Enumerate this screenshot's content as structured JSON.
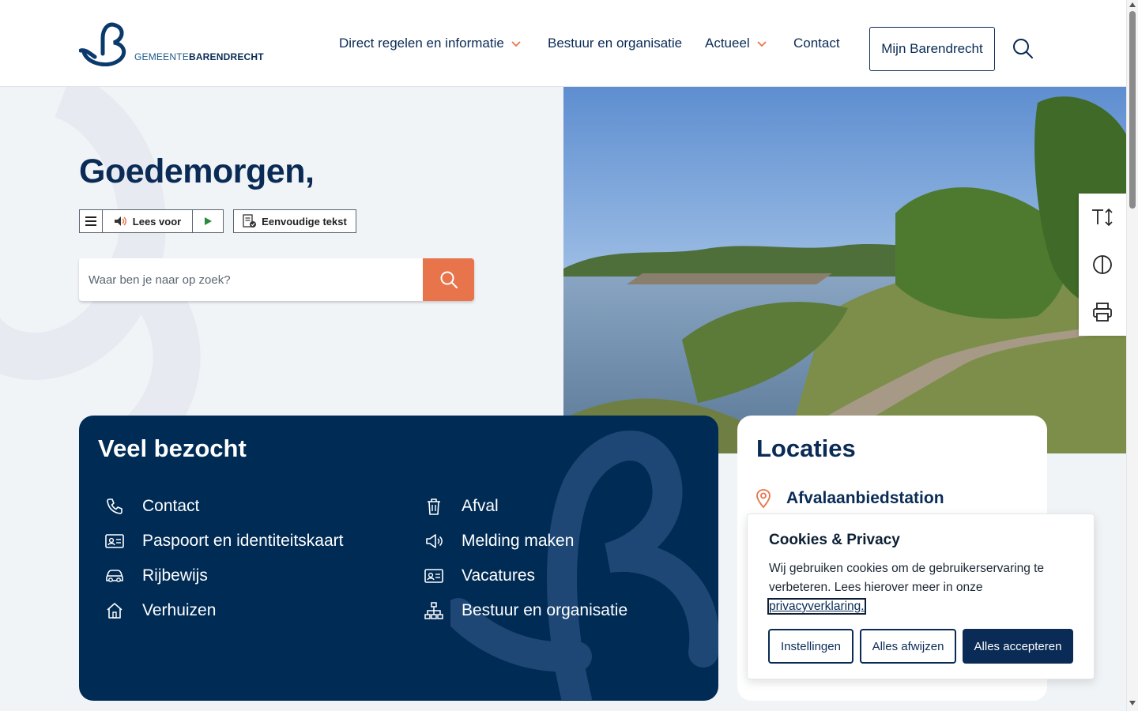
{
  "header": {
    "logo_prefix": "GEMEENTE",
    "logo_name": "BARENDRECHT",
    "nav": [
      {
        "label": "Direct regelen en informatie",
        "has_dropdown": true
      },
      {
        "label": "Bestuur en organisatie",
        "has_dropdown": false
      },
      {
        "label": "Actueel",
        "has_dropdown": true
      },
      {
        "label": "Contact",
        "has_dropdown": false
      }
    ],
    "mijn_label": "Mijn Barendrecht",
    "search_icon": "magnifier-icon"
  },
  "hero": {
    "greeting": "Goedemorgen,",
    "readspeaker": {
      "menu_icon": "menu-icon",
      "lees_voor": "Lees voor",
      "play_icon": "play-icon"
    },
    "simple_text": "Eenvoudige tekst",
    "search": {
      "placeholder": "Waar ben je naar op zoek?",
      "value": ""
    }
  },
  "tools": [
    {
      "name": "text-size-icon"
    },
    {
      "name": "contrast-icon"
    },
    {
      "name": "print-icon"
    }
  ],
  "veel_bezocht": {
    "title": "Veel bezocht",
    "links": [
      {
        "label": "Contact",
        "icon": "phone-icon"
      },
      {
        "label": "Paspoort en identiteitskaart",
        "icon": "id-card-icon"
      },
      {
        "label": "Rijbewijs",
        "icon": "car-icon"
      },
      {
        "label": "Verhuizen",
        "icon": "home-icon"
      },
      {
        "label": "Afval",
        "icon": "trash-icon"
      },
      {
        "label": "Melding maken",
        "icon": "megaphone-icon"
      },
      {
        "label": "Vacatures",
        "icon": "contact-card-icon"
      },
      {
        "label": "Bestuur en organisatie",
        "icon": "org-chart-icon"
      }
    ]
  },
  "locaties": {
    "title": "Locaties",
    "items": [
      {
        "label": "Afvalaanbiedstation",
        "icon": "location-pin-icon"
      }
    ]
  },
  "cookie": {
    "title": "Cookies & Privacy",
    "text": "Wij gebruiken cookies om de gebruikerservaring te verbeteren. Lees hierover meer in onze",
    "link": "privacyverklaring.",
    "buttons": {
      "settings": "Instellingen",
      "reject": "Alles afwijzen",
      "accept": "Alles accepteren"
    }
  },
  "colors": {
    "navy": "#0a2b56",
    "accent": "#e8744c",
    "dark_panel": "#002b55",
    "background": "#f1f4f7"
  }
}
